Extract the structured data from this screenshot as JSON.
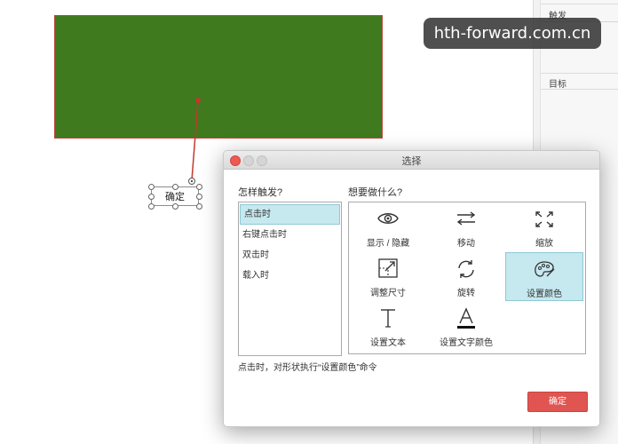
{
  "watermark": "hth-forward.com.cn",
  "canvas": {
    "button_shape_label": "确定"
  },
  "right_panel": {
    "trigger_label": "触发",
    "target_label": "目标"
  },
  "dialog": {
    "title": "选择",
    "trigger_heading": "怎样触发?",
    "action_heading": "想要做什么?",
    "triggers": [
      "点击时",
      "右键点击时",
      "双击时",
      "载入时"
    ],
    "actions": [
      {
        "label": "显示 / 隐藏",
        "icon": "eye-icon"
      },
      {
        "label": "移动",
        "icon": "move-arrows-icon"
      },
      {
        "label": "缩放",
        "icon": "expand-icon"
      },
      {
        "label": "调整尺寸",
        "icon": "resize-icon"
      },
      {
        "label": "旋转",
        "icon": "rotate-icon"
      },
      {
        "label": "设置颜色",
        "icon": "palette-icon"
      },
      {
        "label": "设置文本",
        "icon": "text-icon"
      },
      {
        "label": "设置文字颜色",
        "icon": "text-color-icon"
      }
    ],
    "description": "点击时，对形状执行“设置颜色”命令",
    "confirm_label": "确定"
  },
  "colors": {
    "shape_fill": "#3f7a1f",
    "shape_border": "#b9483a",
    "selection": "#c6e8ef",
    "confirm": "#e05551",
    "close_dot": "#ee5a52",
    "inactive_dot": "#d5d5d5"
  }
}
